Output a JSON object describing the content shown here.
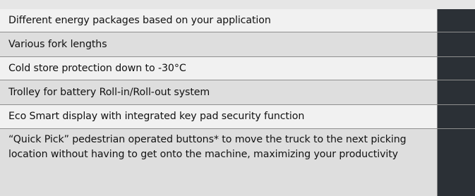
{
  "features": [
    {
      "label": "Different energy packages based on your application"
    },
    {
      "label": "Various fork lengths"
    },
    {
      "label": "Cold store protection down to -30°C"
    },
    {
      "label": "Trolley for battery Roll-in/Roll-out system"
    },
    {
      "label": "Eco Smart display with integrated key pad security function"
    },
    {
      "label": "“Quick Pick” pedestrian operated buttons* to move the truck to the next picking location without having to get onto the machine, maximizing your productivity"
    }
  ],
  "colors": {
    "row_light": "#f1f1f1",
    "row_dark": "#dedede",
    "indicator": "#2b3036",
    "background": "#e6e6e6"
  }
}
